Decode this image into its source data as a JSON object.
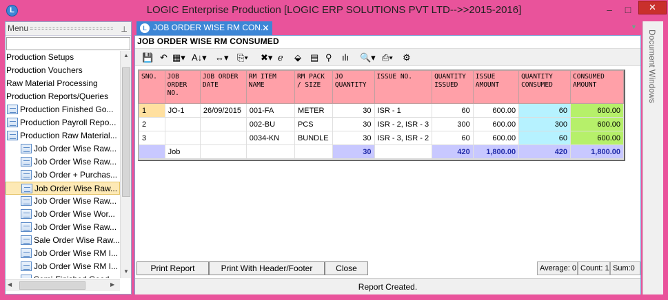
{
  "window": {
    "title": "LOGIC Enterprise Production  [LOGIC ERP SOLUTIONS PVT LTD-->>2015-2016]",
    "app_icon": "L",
    "minimize": "–",
    "maximize": "□",
    "close": "✕"
  },
  "menu": {
    "header": "Menu",
    "pin": "📌",
    "items": [
      {
        "label": "Production Setups",
        "icon": false
      },
      {
        "label": "Production Vouchers",
        "icon": false
      },
      {
        "label": "Raw Material Processing",
        "icon": false
      },
      {
        "label": "Production Reports/Queries",
        "icon": false
      },
      {
        "label": "Production Finished Go...",
        "icon": true,
        "indent": 0
      },
      {
        "label": "Production Payroll Repo...",
        "icon": true,
        "indent": 0
      },
      {
        "label": "Production Raw Material...",
        "icon": true,
        "indent": 0
      },
      {
        "label": "Job Order Wise Raw...",
        "icon": true,
        "indent": 1
      },
      {
        "label": "Job Order Wise Raw...",
        "icon": true,
        "indent": 1
      },
      {
        "label": "Job Order + Purchas...",
        "icon": true,
        "indent": 1
      },
      {
        "label": "Job Order Wise Raw...",
        "icon": true,
        "indent": 1,
        "selected": true
      },
      {
        "label": "Job Order Wise Raw...",
        "icon": true,
        "indent": 1
      },
      {
        "label": "Job Order Wise Wor...",
        "icon": true,
        "indent": 1
      },
      {
        "label": "Job Order Wise Raw...",
        "icon": true,
        "indent": 1
      },
      {
        "label": "Sale Order Wise Raw...",
        "icon": true,
        "indent": 1
      },
      {
        "label": "Job Order Wise RM I...",
        "icon": true,
        "indent": 1
      },
      {
        "label": "Job Order Wise RM I...",
        "icon": true,
        "indent": 1
      },
      {
        "label": "Semi-Finished  Good...",
        "icon": true,
        "indent": 1
      }
    ]
  },
  "tab": {
    "label": "JOB ORDER WISE RM CON...",
    "icon": "L",
    "close": "✕"
  },
  "report": {
    "title": "JOB ORDER WISE RM CONSUMED"
  },
  "toolbar": [
    "💾",
    "↶",
    "▦▾",
    "A↓▾",
    "↔▾",
    "⎘▾",
    "✖▾",
    "ℯ",
    "⬙",
    "▤",
    "⚲",
    "ılı",
    "🔍▾",
    "⎙▾",
    "⚙"
  ],
  "table": {
    "headers": [
      "SNO.",
      "JOB ORDER NO.",
      "JOB ORDER DATE",
      "RM ITEM NAME",
      "RM PACK / SIZE",
      "JO QUANTITY",
      "ISSUE NO.",
      "QUANTITY ISSUED",
      "ISSUE AMOUNT",
      "QUANTITY CONSUMED",
      "CONSUMED AMOUNT"
    ],
    "rows": [
      [
        "1",
        "JO-1",
        "26/09/2015",
        "001-FA",
        "METER",
        "30",
        "ISR - 1",
        "60",
        "600.00",
        "60",
        "600.00"
      ],
      [
        "2",
        "",
        "",
        "002-BU",
        "PCS",
        "30",
        "ISR - 2, ISR - 3",
        "300",
        "600.00",
        "300",
        "600.00"
      ],
      [
        "3",
        "",
        "",
        "0034-KN",
        "BUNDLE",
        "30",
        "ISR - 3, ISR - 2",
        "60",
        "600.00",
        "60",
        "600.00"
      ]
    ],
    "total": [
      "",
      "Job",
      "",
      "",
      "",
      "30",
      "",
      "420",
      "1,800.00",
      "420",
      "1,800.00"
    ]
  },
  "buttons": {
    "print": "Print Report",
    "print_hf": "Print With Header/Footer",
    "close": "Close"
  },
  "stats": {
    "average": "Average: 0",
    "count": "Count: 1",
    "sum": "Sum:0"
  },
  "status": "Report Created.",
  "docwin": "Document Windows"
}
